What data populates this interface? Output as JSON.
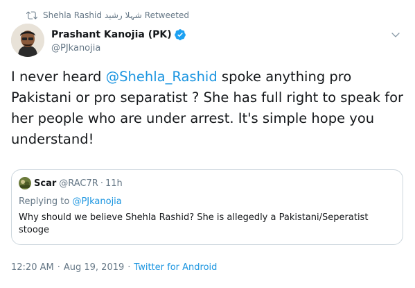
{
  "retweet": {
    "name": "Shehla Rashid",
    "name_urdu": "شہلا رشید",
    "label": "Retweeted"
  },
  "author": {
    "name": "Prashant Kanojia (PK)",
    "handle": "@PJkanojia"
  },
  "tweet": {
    "text_before": "I never heard ",
    "mention": "@Shehla_Rashid",
    "text_after": " spoke anything pro Pakistani or pro separatist ? She has full right to speak for her people who are under arrest. It's simple hope you understand!"
  },
  "quote": {
    "name": "Scar",
    "handle": "@RAC7R",
    "dot": "·",
    "time": "11h",
    "replying_label": "Replying to ",
    "replying_handle": "@PJkanojia",
    "text": "Why should we believe Shehla Rashid? She is allegedly a Pakistani/Seperatist stooge"
  },
  "meta": {
    "time": "12:20 AM",
    "sep1": "·",
    "date": "Aug 19, 2019",
    "sep2": "·",
    "source": "Twitter for Android"
  },
  "icons": {
    "retweet": "retweet-icon",
    "verified": "verified-badge-icon",
    "caret": "chevron-down-icon"
  },
  "colors": {
    "link": "#1b95e0",
    "secondary": "#657786",
    "border": "#ccd6dd",
    "verified": "#1da1f2"
  }
}
